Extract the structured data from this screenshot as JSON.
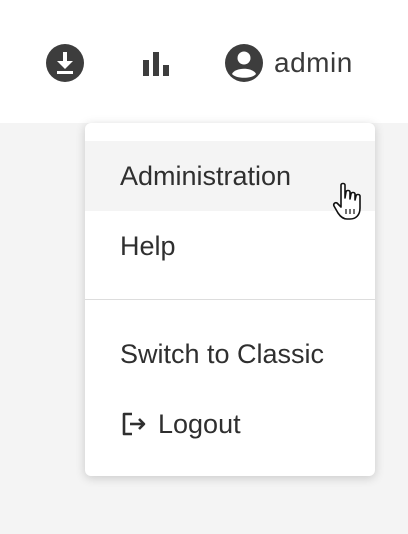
{
  "header": {
    "download_icon": "download-circle-icon",
    "stats_icon": "bar-chart-icon",
    "user_icon": "account-circle-icon",
    "user_label": "admin"
  },
  "menu": {
    "items": [
      {
        "label": "Administration",
        "state": "hover"
      },
      {
        "label": "Help"
      },
      {
        "label": "Switch to Classic"
      },
      {
        "label": "Logout",
        "icon": "logout-icon"
      }
    ]
  },
  "colors": {
    "icon": "#3d3d3d",
    "hover_bg": "#f4f4f4",
    "page_bg": "#f4f4f4"
  }
}
